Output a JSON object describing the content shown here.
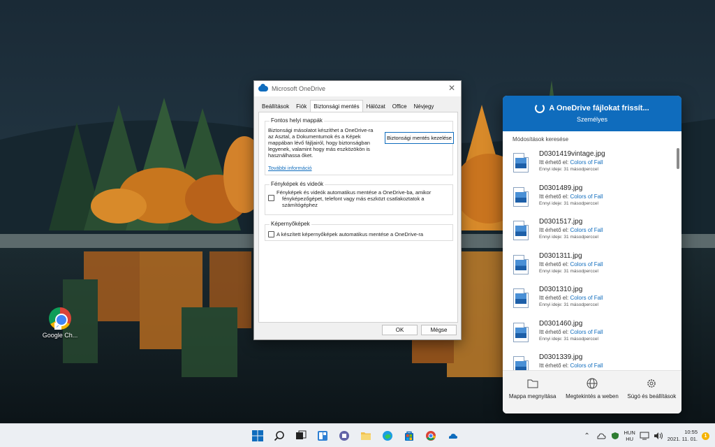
{
  "desktop": {
    "icons": [
      {
        "label": "Google Ch...",
        "icon": "chrome-icon"
      }
    ]
  },
  "dialog": {
    "title": "Microsoft OneDrive",
    "tabs": [
      "Beállítások",
      "Fiók",
      "Biztonsági mentés",
      "Hálózat",
      "Office",
      "Névjegy"
    ],
    "active_tab": "Biztonsági mentés",
    "important_folders": {
      "title": "Fontos helyi mappák",
      "text": "Biztonsági másolatot készíthet a OneDrive-ra az Asztal, a Dokumentumok és a Képek mappában lévő fájljairól, hogy biztonságban legyenek, valamint hogy más eszközökön is használhassa őket.",
      "manage_button": "Biztonsági mentés kezelése",
      "more_info": "További információ"
    },
    "photos_videos": {
      "title": "Fényképek és videók",
      "checkbox_label": "Fényképek és videók automatikus mentése a OneDrive-ba, amikor fényképezőgépet, telefont vagy más eszközt csatlakoztatok a számítógéphez",
      "checked": false
    },
    "screenshots": {
      "title": "Képernyőképek",
      "checkbox_label": "A készített képernyőképek automatikus mentése a OneDrive-ra",
      "checked": false
    },
    "ok": "OK",
    "cancel": "Mégse"
  },
  "flyout": {
    "status": "A OneDrive fájlokat frissít...",
    "account": "Személyes",
    "search": "Módosítások keresése",
    "files": [
      {
        "name": "D0301419vintage.jpg",
        "loc_prefix": "Itt érhető el:",
        "loc": "Colors of Fall",
        "time": "Ennyi ideje: 31 másodperccel"
      },
      {
        "name": "D0301489.jpg",
        "loc_prefix": "Itt érhető el:",
        "loc": "Colors of Fall",
        "time": "Ennyi ideje: 31 másodperccel"
      },
      {
        "name": "D0301517.jpg",
        "loc_prefix": "Itt érhető el:",
        "loc": "Colors of Fall",
        "time": "Ennyi ideje: 31 másodperccel"
      },
      {
        "name": "D0301311.jpg",
        "loc_prefix": "Itt érhető el:",
        "loc": "Colors of Fall",
        "time": "Ennyi ideje: 31 másodperccel"
      },
      {
        "name": "D0301310.jpg",
        "loc_prefix": "Itt érhető el:",
        "loc": "Colors of Fall",
        "time": "Ennyi ideje: 31 másodperccel"
      },
      {
        "name": "D0301460.jpg",
        "loc_prefix": "Itt érhető el:",
        "loc": "Colors of Fall",
        "time": "Ennyi ideje: 31 másodperccel"
      },
      {
        "name": "D0301339.jpg",
        "loc_prefix": "Itt érhető el:",
        "loc": "Colors of Fall",
        "time": ""
      }
    ],
    "footer": [
      {
        "label": "Mappa megnyitása",
        "icon": "folder-icon"
      },
      {
        "label": "Megtekintés a weben",
        "icon": "globe-icon"
      },
      {
        "label": "Súgó és beállítások",
        "icon": "gear-icon"
      }
    ]
  },
  "taskbar": {
    "apps": [
      "start-icon",
      "search-icon",
      "task-view-icon",
      "widgets-icon",
      "teams-chat-icon",
      "file-explorer-icon",
      "edge-icon",
      "store-icon",
      "chrome-icon",
      "onedrive-icon"
    ],
    "lang_top": "HUN",
    "lang_bottom": "HU",
    "time": "10:55",
    "date": "2021. 11. 01.",
    "notifications": "1"
  },
  "colors": {
    "accent": "#0f6cbd",
    "taskbar": "#eceff3"
  }
}
